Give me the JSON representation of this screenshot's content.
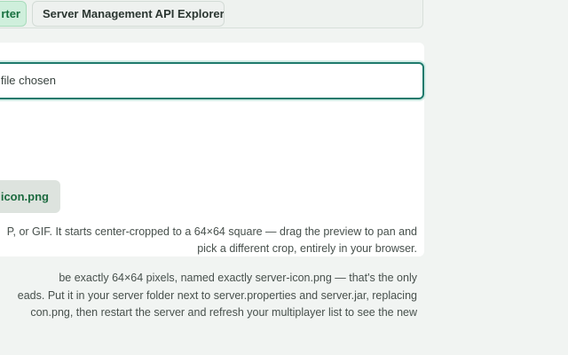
{
  "tabs": [
    {
      "label": "rter",
      "active": true
    },
    {
      "label": "Server Management API Explorer",
      "active": false
    }
  ],
  "uploader": {
    "file_status": "o file chosen",
    "download_label": "icon.png",
    "hint_lines": [
      "P, or GIF. It starts center-cropped to a 64×64 square — drag the preview to pan and",
      "pick a different crop, entirely in your browser."
    ]
  },
  "info": {
    "lines": [
      "be exactly 64×64 pixels, named exactly server-icon.png — that's the only",
      "eads. Put it in your server folder next to server.properties and server.jar, replacing",
      "con.png, then restart the server and refresh your multiplayer list to see the new"
    ]
  },
  "colors": {
    "page_bg": "#f1f4f2",
    "accent": "#1f7a6c",
    "active_tab_bg": "#cfefdc",
    "download_text": "#1d6b40"
  }
}
